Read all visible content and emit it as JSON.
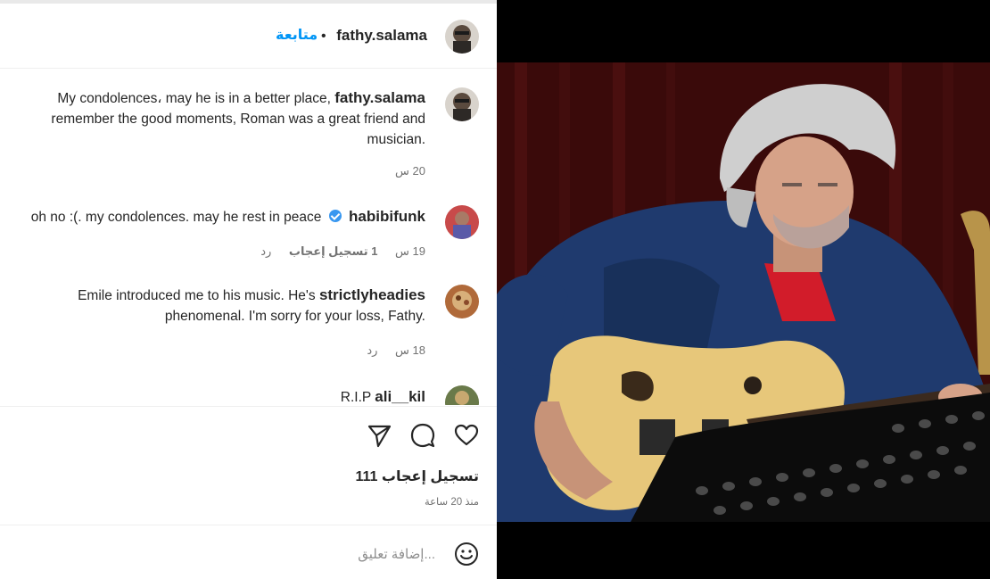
{
  "header": {
    "username": "fathy.salama",
    "dot": "•",
    "follow_label": "متابعة"
  },
  "comments": [
    {
      "username": "fathy.salama",
      "text_line1": "My condolences، may he is in a better place,",
      "text_rest": "remember the good moments, Roman was a great friend and musician.",
      "time": "20 س"
    },
    {
      "username": "habibifunk",
      "text": "oh no :(. my condolences. may he rest in peace",
      "time": "19 س",
      "likes": "1 تسجيل إعجاب",
      "reply": "رد"
    },
    {
      "username": "strictlyheadies",
      "text_line1": "Emile introduced me to his music. He's",
      "text_rest": "phenomenal. I'm sorry for your loss, Fathy.",
      "time": "18 س",
      "reply": "رد"
    },
    {
      "username": "ali__kil",
      "text": "R.I.P"
    }
  ],
  "actions": {
    "like_icon": "heart-icon",
    "comment_icon": "comment-bubble-icon",
    "share_icon": "send-icon"
  },
  "post": {
    "likes_label": "111 تسجيل إعجاب",
    "time_ago": "منذ 20 ساعة"
  },
  "composer": {
    "placeholder": "إضافة تعليق...",
    "emoji_icon": "smiley-icon"
  },
  "colors": {
    "follow": "#0095f6",
    "verified": "#3897f0",
    "text": "#262626",
    "muted": "#737373"
  }
}
